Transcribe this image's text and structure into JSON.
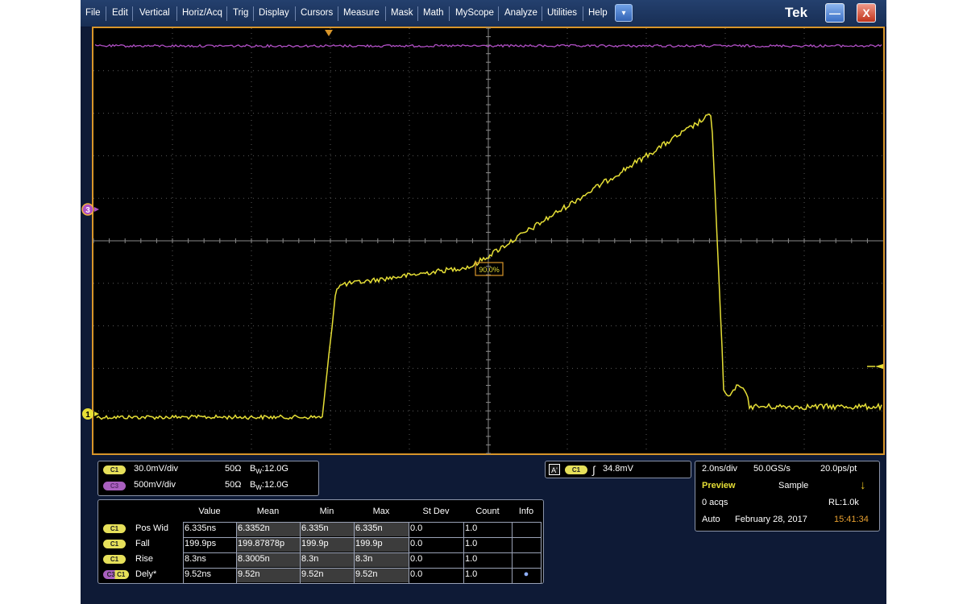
{
  "menu": {
    "items": [
      "File",
      "Edit",
      "Vertical",
      "Horiz/Acq",
      "Trig",
      "Display",
      "Cursors",
      "Measure",
      "Mask",
      "Math",
      "MyScope",
      "Analyze",
      "Utilities",
      "Help"
    ],
    "dropdown_glyph": "▾",
    "brand": "Tek",
    "minimize_glyph": "—",
    "close_glyph": "X"
  },
  "display": {
    "channel1_marker": "1",
    "channel3_marker": "3",
    "mid_annotation": "90.0%",
    "trace_colors": {
      "ch1": "#e6df36",
      "ch3": "#b04fc4"
    },
    "trigger_marker_color": "#d8952a"
  },
  "channels": [
    {
      "badge": "C1",
      "scale": "30.0mV/div",
      "impedance": "50Ω",
      "bw_prefix": "B",
      "bw_sub": "W",
      "bw_value": ":12.0G"
    },
    {
      "badge": "C3",
      "scale": "500mV/div",
      "impedance": "50Ω",
      "bw_prefix": "B",
      "bw_sub": "W",
      "bw_value": ":12.0G"
    }
  ],
  "trigger": {
    "mode_badge": "A'",
    "source_badge": "C1",
    "slope_glyph": "∫",
    "level": "34.8mV"
  },
  "acquisition": {
    "time_per_div": "2.0ns/div",
    "sample_rate": "50.0GS/s",
    "resolution": "20.0ps/pt",
    "status": "Preview",
    "mode": "Sample",
    "indicator_glyph": "↓",
    "acqs": "0 acqs",
    "record_length": "RL:1.0k",
    "trigger_mode": "Auto",
    "date": "February 28, 2017",
    "time": "15:41:34"
  },
  "measurements": {
    "headers": [
      "Value",
      "Mean",
      "Min",
      "Max",
      "St Dev",
      "Count",
      "Info"
    ],
    "rows": [
      {
        "badge": "C1",
        "name": "Pos Wid",
        "value": "6.335ns",
        "mean": "6.3352n",
        "min": "6.335n",
        "max": "6.335n",
        "stdev": "0.0",
        "count": "1.0",
        "info": ""
      },
      {
        "badge": "C1",
        "name": "Fall",
        "value": "199.9ps",
        "mean": "199.87878p",
        "min": "199.9p",
        "max": "199.9p",
        "stdev": "0.0",
        "count": "1.0",
        "info": ""
      },
      {
        "badge": "C1",
        "name": "Rise",
        "value": "8.3ns",
        "mean": "8.3005n",
        "min": "8.3n",
        "max": "8.3n",
        "stdev": "0.0",
        "count": "1.0",
        "info": ""
      },
      {
        "badge": "C3 C1",
        "name": "Dely*",
        "value": "9.52ns",
        "mean": "9.52n",
        "min": "9.52n",
        "max": "9.52n",
        "stdev": "0.0",
        "count": "1.0",
        "info": "●"
      }
    ]
  }
}
